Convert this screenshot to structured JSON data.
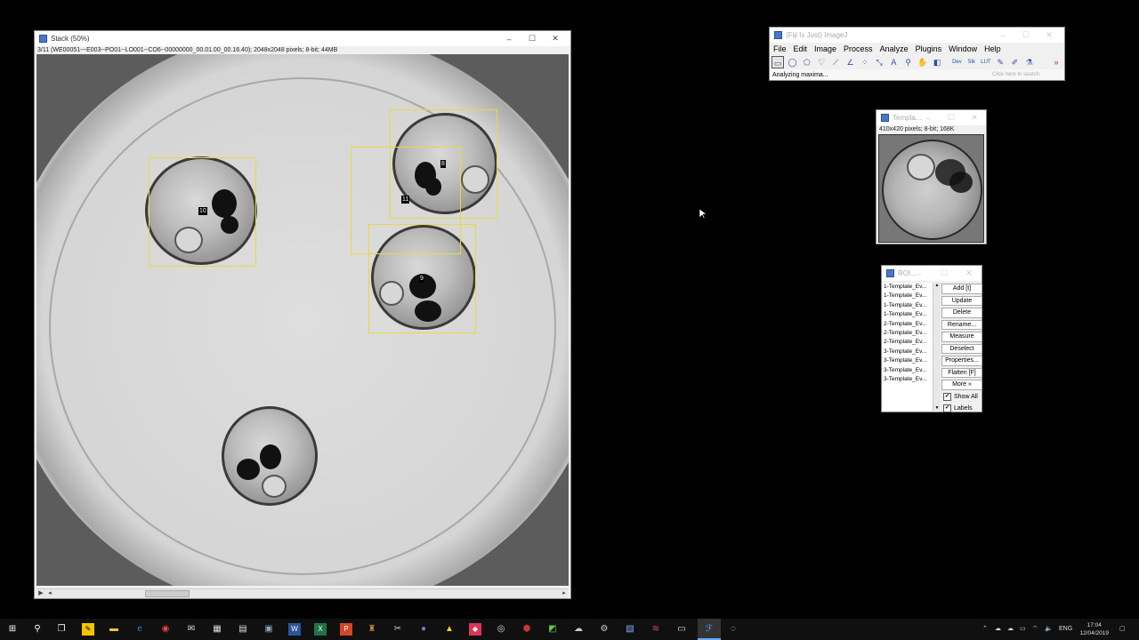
{
  "stack_window": {
    "title": "Stack (50%)",
    "info": "3/11 (WE00051---E003--PO01--LO001--CO6--00000000_00.01.00_00.16.40); 2048x2048 pixels; 8-bit; 44MB",
    "roi_labels": [
      "10",
      "8",
      "11",
      "9"
    ],
    "minimize": "–",
    "maximize": "☐",
    "close": "✕",
    "scroll_left": "◂",
    "scroll_right": "▸",
    "play": "▶"
  },
  "fiji_window": {
    "title": "(Fiji Is Just) ImageJ",
    "menus": [
      "File",
      "Edit",
      "Image",
      "Process",
      "Analyze",
      "Plugins",
      "Window",
      "Help"
    ],
    "tools": [
      "▭",
      "◯",
      "⬠",
      "♡",
      "⟋",
      "∠",
      "⁘",
      "⤡",
      "A",
      "⚲",
      "✋",
      "◧",
      "Dev",
      "Stk",
      "LUT",
      "✎",
      "✐",
      "⚗",
      "»"
    ],
    "status": "Analyzing  maxima...",
    "search_placeholder": "Click here to search"
  },
  "template_window": {
    "title": "Templa...",
    "info": "410x420 pixels; 8-bit; 168K"
  },
  "roi_manager": {
    "title": "ROI...",
    "items": [
      "1-Template_Ev...",
      "1-Template_Ev...",
      "1-Template_Ev...",
      "1-Template_Ev...",
      "2-Template_Ev...",
      "2-Template_Ev...",
      "2-Template_Ev...",
      "3-Template_Ev...",
      "3-Template_Ev...",
      "3-Template_Ev...",
      "3-Template_Ev..."
    ],
    "buttons": [
      "Add [t]",
      "Update",
      "Delete",
      "Rename...",
      "Measure",
      "Deselect",
      "Properties...",
      "Flatten [F]",
      "More »"
    ],
    "show_all": "Show All",
    "labels": "Labels",
    "check": "✔"
  },
  "taskbar": {
    "language": "ENG",
    "time": "17:04",
    "date": "12/04/2019"
  }
}
